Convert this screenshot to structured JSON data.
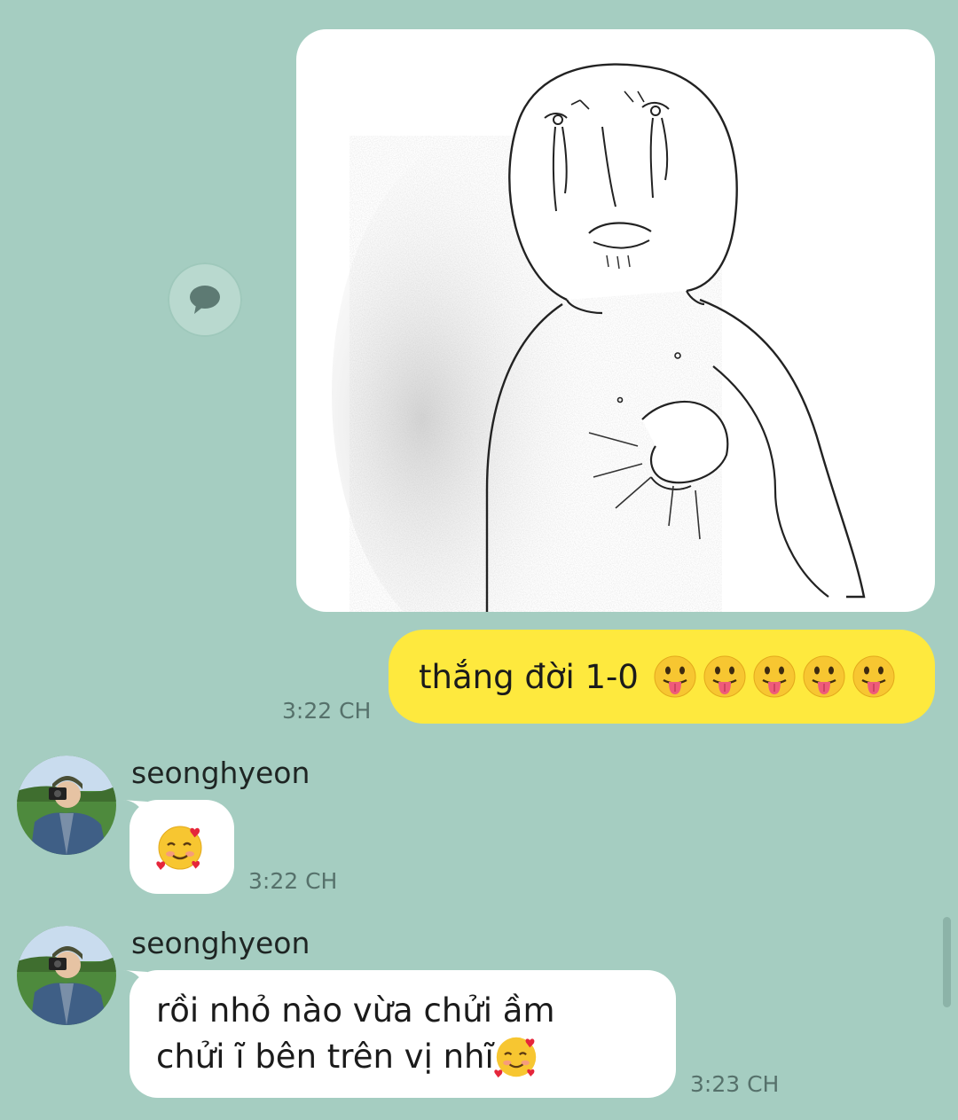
{
  "messages": {
    "outgoing_image": {
      "alt": "crying-meme-drawing"
    },
    "outgoing_text": {
      "text": "thắng đời 1-0",
      "emoji_count": 5,
      "emoji_icon": "face-with-tongue-emoji",
      "time": "3:22 CH"
    },
    "incoming_1": {
      "sender": "seonghyeon",
      "emoji_icon": "smiling-face-with-hearts-emoji",
      "time": "3:22 CH"
    },
    "incoming_2": {
      "sender": "seonghyeon",
      "line1": "rồi nhỏ nào vừa chửi ầm",
      "line2": "chửi ĩ bên trên vị nhĩ",
      "emoji_icon": "smiling-face-with-hearts-emoji",
      "time": "3:23 CH"
    }
  },
  "colors": {
    "background": "#a5cdc1",
    "outgoing_bubble": "#fee93e",
    "incoming_bubble": "#ffffff",
    "timestamp": "#56716b"
  },
  "icons": {
    "share": "speech-bubble-icon"
  }
}
